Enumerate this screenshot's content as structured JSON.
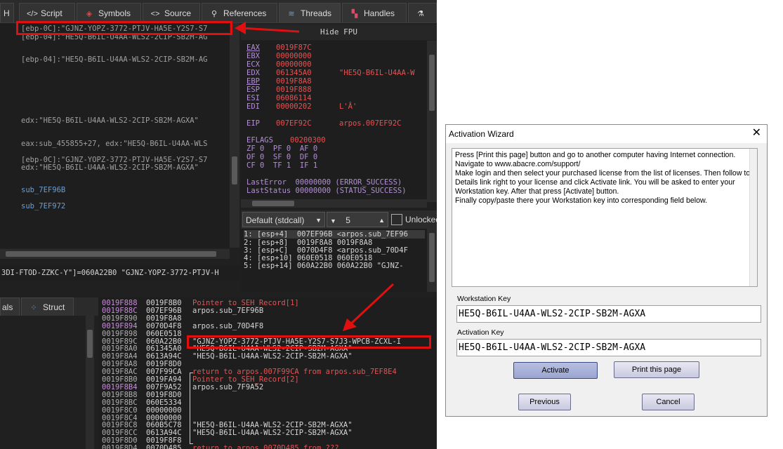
{
  "debugger": {
    "tabs": [
      {
        "label": "Script",
        "icon": "script-icon"
      },
      {
        "label": "Symbols",
        "icon": "symbols-icon"
      },
      {
        "label": "Source",
        "icon": "source-icon"
      },
      {
        "label": "References",
        "icon": "references-icon"
      },
      {
        "label": "Threads",
        "icon": "threads-icon"
      },
      {
        "label": "Handles",
        "icon": "handles-icon"
      }
    ],
    "first_tab_fragment": "H",
    "disasm_lines": [
      "[ebp-0C]:\"GJNZ-YOPZ-3772-PTJV-HA5E-Y2S7-S7",
      "[ebp-04]:\"HE5Q-B6IL-U4AA-WLS2-2CIP-SB2M-AG",
      "[ebp-04]:\"HE5Q-B6IL-U4AA-WLS2-2CIP-SB2M-AG",
      "edx:\"HE5Q-B6IL-U4AA-WLS2-2CIP-SB2M-AGXA\"",
      "eax:sub_455855+27, edx:\"HE5Q-B6IL-U4AA-WLS",
      "[ebp-0C]:\"GJNZ-YOPZ-3772-PTJV-HA5E-Y2S7-S7",
      "edx:\"HE5Q-B6IL-U4AA-WLS2-2CIP-SB2M-AGXA\"",
      "sub_7EF96B",
      "sub_7EF972"
    ],
    "hide_fpu": "Hide FPU",
    "registers": [
      {
        "name": "EAX",
        "value": "0019F87C",
        "comment": ""
      },
      {
        "name": "EBX",
        "value": "00000000",
        "comment": ""
      },
      {
        "name": "ECX",
        "value": "00000000",
        "comment": ""
      },
      {
        "name": "EDX",
        "value": "061345A0",
        "comment": "\"HE5Q-B6IL-U4AA-W"
      },
      {
        "name": "EBP",
        "value": "0019F8A8",
        "comment": ""
      },
      {
        "name": "ESP",
        "value": "0019F888",
        "comment": ""
      },
      {
        "name": "ESI",
        "value": "06086114",
        "comment": ""
      },
      {
        "name": "EDI",
        "value": "00000202",
        "comment": "L'Â'"
      }
    ],
    "eip": {
      "name": "EIP",
      "value": "007EF92C",
      "comment": "arpos.007EF92C"
    },
    "eflags": {
      "name": "EFLAGS",
      "value": "00200300"
    },
    "flag_rows": [
      "ZF 0  PF 0  AF 0",
      "OF 0  SF 0  DF 0",
      "CF 0  TF 1  IF 1"
    ],
    "last_error": "LastError  00000000 (ERROR_SUCCESS)",
    "last_status": "LastStatus 00000000 (STATUS_SUCCESS)",
    "call_conv": "Default (stdcall)",
    "arg_count": "5",
    "unlocked_label": "Unlocked",
    "call_stack": [
      "1: [esp+4]  007EF96B <arpos.sub_7EF96",
      "2: [esp+8]  0019F8A8 0019F8A8",
      "3: [esp+C]  0070D4F8 <arpos.sub_70D4F",
      "4: [esp+10] 060E0518 060E0518",
      "5: [esp+14] 060A22B0 060A22B0 \"GJNZ-"
    ],
    "info_line": "3DI-FTOD-ZZKC-Y\"]=060A22B0 \"GJNZ-YOPZ-3772-PTJV-H",
    "lower_tabs": [
      {
        "label": "als"
      },
      {
        "label": "Struct",
        "icon": "struct-icon"
      }
    ],
    "stack_rows": [
      {
        "addr": "0019F888",
        "val": "0019F8B0",
        "comment": "Pointer to SEH_Record[1]",
        "red": true,
        "hl": true
      },
      {
        "addr": "0019F88C",
        "val": "007EF96B",
        "comment": "arpos.sub_7EF96B",
        "red": false,
        "hl": true
      },
      {
        "addr": "0019F890",
        "val": "0019F8A8",
        "comment": "",
        "red": false,
        "hl": false
      },
      {
        "addr": "0019F894",
        "val": "0070D4F8",
        "comment": "arpos.sub_70D4F8",
        "red": false,
        "hl": true
      },
      {
        "addr": "0019F898",
        "val": "060E0518",
        "comment": "",
        "red": false,
        "hl": false
      },
      {
        "addr": "0019F89C",
        "val": "060A22B0",
        "comment": "\"GJNZ-YOPZ-3772-PTJV-HA5E-Y2S7-S7J3-WPCB-ZCXL-I",
        "red": false,
        "hl": false
      },
      {
        "addr": "0019F8A0",
        "val": "061345A0",
        "comment": "\"HE5Q-B6IL-U4AA-WLS2-2CIP-SB2M-AGXA\"",
        "red": false,
        "hl": false
      },
      {
        "addr": "0019F8A4",
        "val": "0613A94C",
        "comment": "\"HE5Q-B6IL-U4AA-WLS2-2CIP-SB2M-AGXA\"",
        "red": false,
        "hl": false
      },
      {
        "addr": "0019F8A8",
        "val": "0019F8D0",
        "comment": "",
        "red": false,
        "hl": false
      },
      {
        "addr": "0019F8AC",
        "val": "007F99CA",
        "comment": "return to arpos.007F99CA from arpos.sub_7EF8E4",
        "red": true,
        "hl": false
      },
      {
        "addr": "0019F8B0",
        "val": "0019FA94",
        "comment": "Pointer to SEH_Record[2]",
        "red": true,
        "hl": false
      },
      {
        "addr": "0019F8B4",
        "val": "007F9A52",
        "comment": "arpos.sub_7F9A52",
        "red": false,
        "hl": true
      },
      {
        "addr": "0019F8B8",
        "val": "0019F8D0",
        "comment": "",
        "red": false,
        "hl": false
      },
      {
        "addr": "0019F8BC",
        "val": "060E5334",
        "comment": "",
        "red": false,
        "hl": false
      },
      {
        "addr": "0019F8C0",
        "val": "00000000",
        "comment": "",
        "red": false,
        "hl": false
      },
      {
        "addr": "0019F8C4",
        "val": "00000000",
        "comment": "",
        "red": false,
        "hl": false
      },
      {
        "addr": "0019F8C8",
        "val": "060B5C78",
        "comment": "\"HE5Q-B6IL-U4AA-WLS2-2CIP-SB2M-AGXA\"",
        "red": false,
        "hl": false
      },
      {
        "addr": "0019F8CC",
        "val": "0613A94C",
        "comment": "\"HE5Q-B6IL-U4AA-WLS2-2CIP-SB2M-AGXA\"",
        "red": false,
        "hl": false
      },
      {
        "addr": "0019F8D0",
        "val": "0019F8F8",
        "comment": "",
        "red": false,
        "hl": false
      },
      {
        "addr": "0019F8D4",
        "val": "0070D485",
        "comment": "return to arpos.0070D485 from ???",
        "red": true,
        "hl": false
      }
    ]
  },
  "wizard": {
    "title": "Activation Wizard",
    "close": "✕",
    "info_lines": [
      "Press [Print this page] button and go to another computer having Internet connection.",
      "Navigate to www.abacre.com/support/",
      "Make login and then select your purchased license from the list of licenses. Then follow to",
      "Details link right to your license and click Activate link. You will be asked to enter your",
      "Workstation key. After that press [Activate] button.",
      "Finally copy/paste there your Workstation key into corresponding field below."
    ],
    "workstation_label": "Workstation Key",
    "workstation_value": "HE5Q-B6IL-U4AA-WLS2-2CIP-SB2M-AGXA",
    "activation_label": "Activation Key",
    "activation_value": "HE5Q-B6IL-U4AA-WLS2-2CIP-SB2M-AGXA",
    "activate_button": "Activate",
    "print_button": "Print this page",
    "previous_button": "Previous",
    "cancel_button": "Cancel"
  }
}
